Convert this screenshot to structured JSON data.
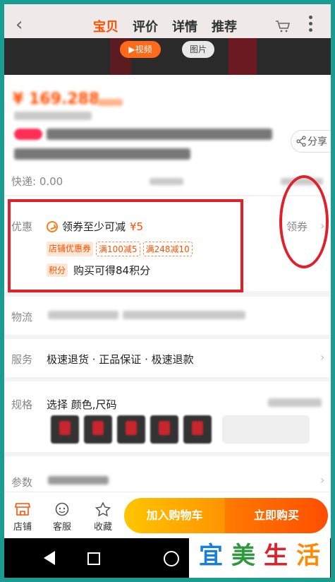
{
  "header": {
    "tabs": [
      {
        "label": "宝贝",
        "active": true
      },
      {
        "label": "评价",
        "active": false
      },
      {
        "label": "详情",
        "active": false
      },
      {
        "label": "推荐",
        "active": false
      }
    ]
  },
  "media": {
    "video_label": "▶视频",
    "photo_label": "图片"
  },
  "product": {
    "price": "¥ 1​69.2​8​8",
    "share_label": "分享",
    "shipping": "快递: 0.00"
  },
  "promo": {
    "label": "优惠",
    "coupon_text": "领券至少可减",
    "coupon_amount": "¥5",
    "claim_label": "领券",
    "tags": [
      "店铺优惠券",
      "满100减5",
      "满248减10"
    ],
    "points_tag": "积分",
    "points_text": "购买可得84积分"
  },
  "logistics": {
    "label": "物流"
  },
  "service": {
    "label": "服务",
    "text": "极速退货 · 正品保证 · 极速退款"
  },
  "specs": {
    "label": "规格",
    "text": "选择 颜色,尺码"
  },
  "params": {
    "label": "参数"
  },
  "bottom_bar": {
    "shop_label": "店铺",
    "service_label": "客服",
    "favorite_label": "收藏",
    "add_cart_label": "加入购物车",
    "buy_now_label": "立即购买"
  },
  "watermark": {
    "chars": [
      "宜",
      "美",
      "生",
      "活"
    ],
    "colors": [
      "#1a7fd6",
      "#2c9a3a",
      "#e0202a",
      "#ff8a00"
    ]
  },
  "colors": {
    "accent": "#ff5000",
    "highlight": "#e0202a"
  }
}
